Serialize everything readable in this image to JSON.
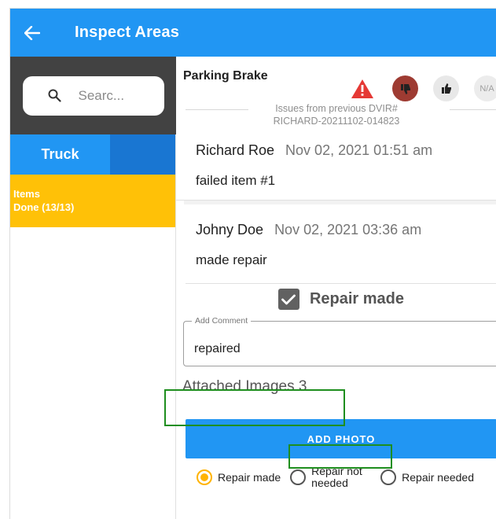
{
  "appbar": {
    "title": "Inspect Areas"
  },
  "sidebar": {
    "search_placeholder": "Searc...",
    "tab_truck": "Truck",
    "items_title": "Items",
    "items_done": "Done (13/13)"
  },
  "detail": {
    "item_name": "Parking Brake",
    "na_label": "N/A",
    "previous_line1": "Issues from previous DVIR#",
    "previous_line2": "RICHARD-20211102-014823",
    "entries": [
      {
        "author": "Richard Roe",
        "datetime": "Nov 02, 2021  01:51 am",
        "text": "failed item #1"
      },
      {
        "author": "Johny Doe",
        "datetime": "Nov 02, 2021  03:36 am",
        "text": "made repair"
      }
    ],
    "repair_made_label": "Repair made",
    "comment_label": "Add Comment",
    "comment_value": "repaired",
    "attached_images": "Attached Images 3",
    "add_photo": "ADD PHOTO",
    "radio_options": [
      {
        "label": "Repair made",
        "selected": true
      },
      {
        "label": "Repair not needed",
        "selected": false
      },
      {
        "label": "Repair needed",
        "selected": false
      }
    ]
  },
  "colors": {
    "primary": "#2196f3",
    "items_bg": "#ffc107",
    "thumbs_down": "#9e3b32",
    "warning": "#e53935",
    "annotation": "#1e8e1e"
  }
}
